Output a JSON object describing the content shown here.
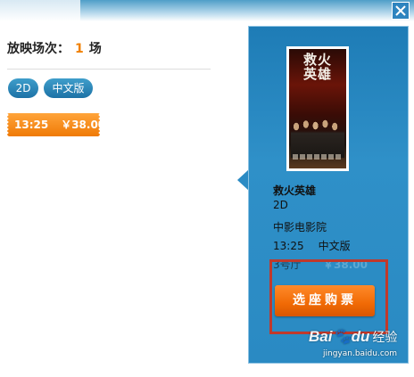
{
  "header": {
    "close_icon": "close-icon"
  },
  "showings": {
    "label": "放映场次：",
    "count": "1",
    "unit": "场"
  },
  "tags": {
    "format": "2D",
    "language": "中文版"
  },
  "showtime_button": {
    "time": "13:25",
    "price": "￥38.00"
  },
  "detail": {
    "poster_title": "救火英雄",
    "film_title": "救火英雄",
    "format": "2D",
    "cinema": "中影电影院",
    "time": "13:25",
    "language": "中文版",
    "hall": "3号厅",
    "price": "￥38.00",
    "buy_label": "选座购票"
  },
  "watermark": {
    "brand": "Bai",
    "brand_suffix": "du",
    "product": "经验",
    "url": "jingyan.baidu.com"
  },
  "colors": {
    "accent_orange": "#f08000",
    "panel_blue": "#2a8ac3",
    "highlight_red": "#c0392b"
  }
}
